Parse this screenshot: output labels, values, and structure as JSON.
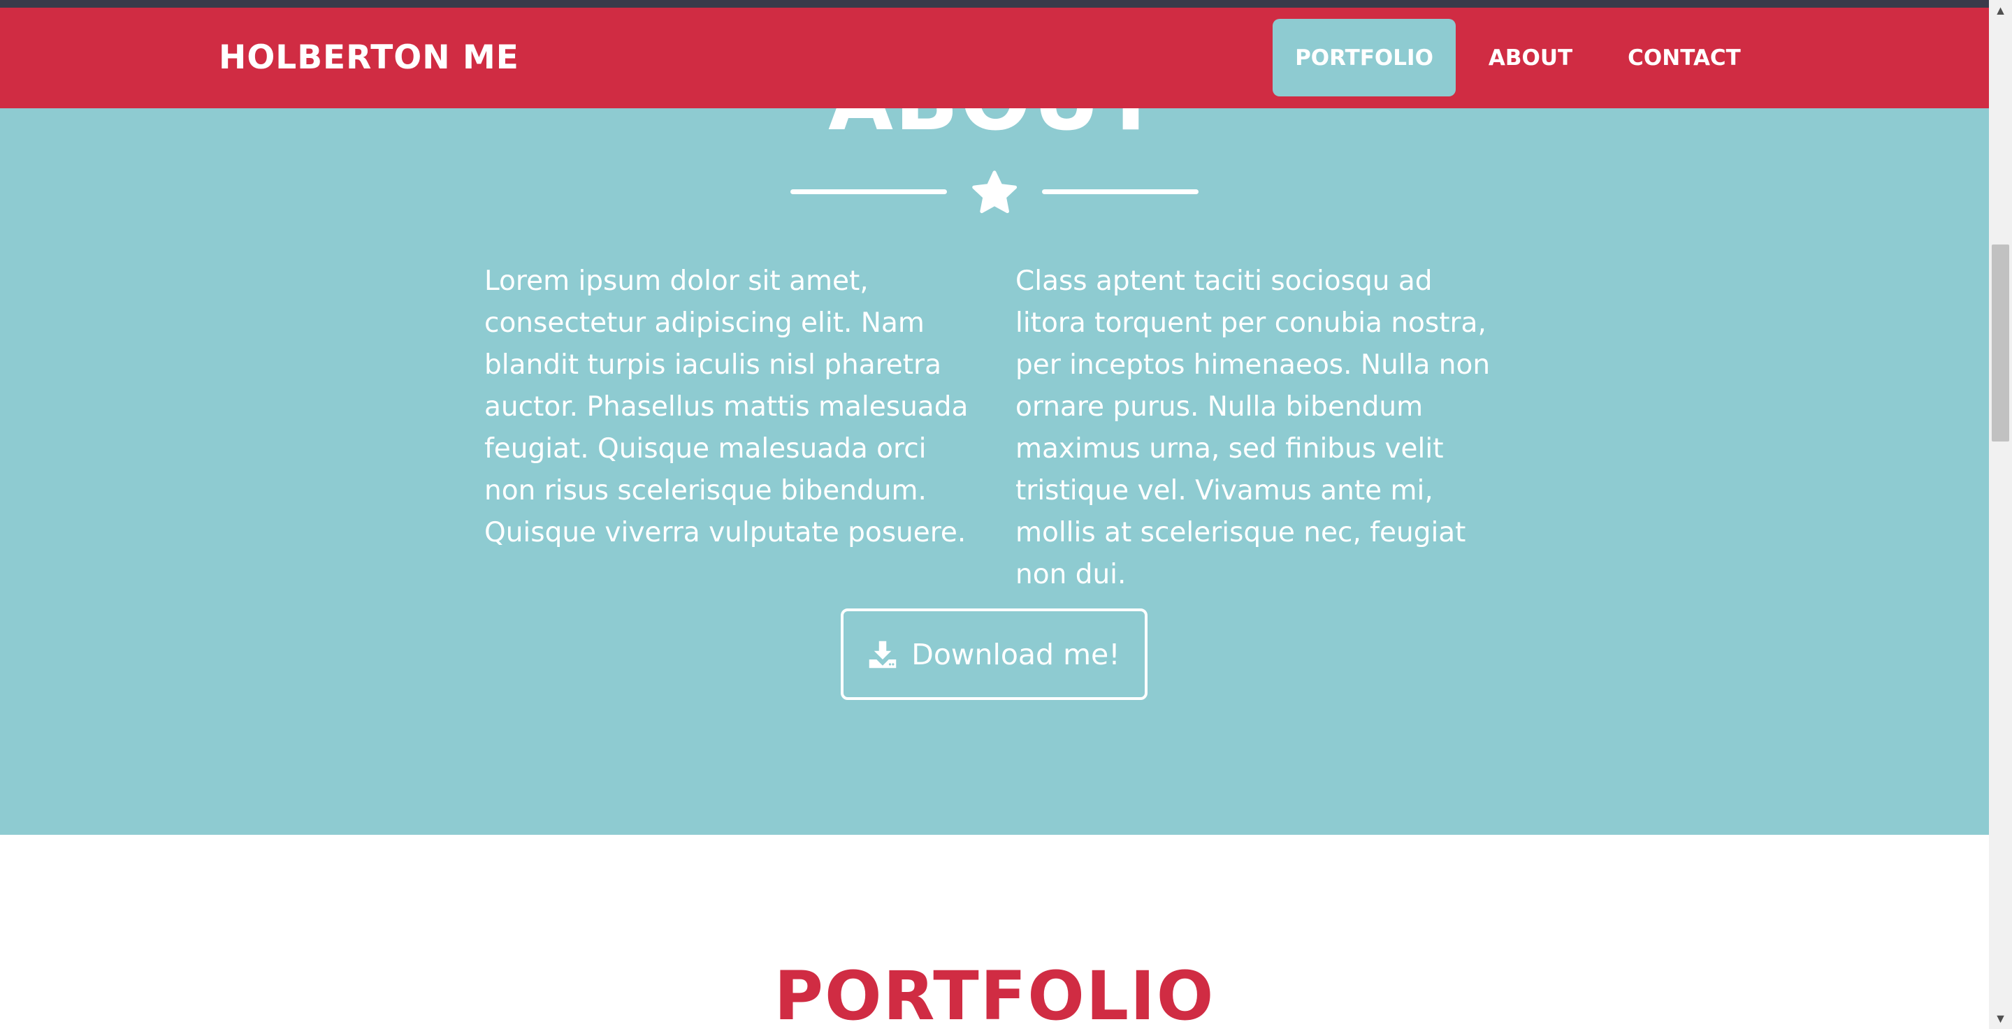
{
  "nav": {
    "brand": "HOLBERTON ME",
    "items": [
      {
        "label": "PORTFOLIO",
        "active": true
      },
      {
        "label": "ABOUT",
        "active": false
      },
      {
        "label": "CONTACT",
        "active": false
      }
    ]
  },
  "about": {
    "title": "ABOUT",
    "divider_icon": "star-icon",
    "col_left": "Lorem ipsum dolor sit amet, consectetur adipiscing elit. Nam blandit turpis iaculis nisl pharetra auctor. Phasellus mattis malesuada feugiat. Quisque malesuada orci non risus scelerisque bibendum. Quisque viverra vulputate posuere.",
    "col_right": "Class aptent taciti sociosqu ad litora torquent per conubia nostra, per inceptos himenaeos. Nulla non ornare purus. Nulla bibendum maximus urna, sed finibus velit tristique vel. Vivamus ante mi, mollis at scelerisque nec, feugiat non dui.",
    "download_label": "Download me!",
    "download_icon": "download-icon"
  },
  "portfolio": {
    "title": "PORTFOLIO"
  },
  "colors": {
    "brand_red": "#d02c43",
    "teal": "#8ecbd1",
    "white": "#ffffff"
  }
}
